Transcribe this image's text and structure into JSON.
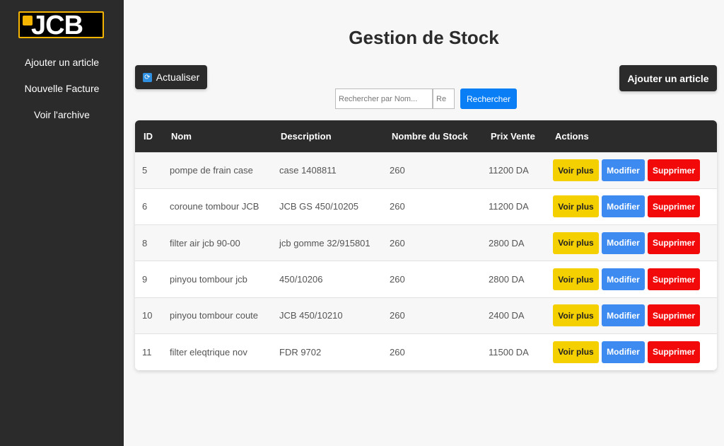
{
  "brand": {
    "logo_text": "JCB",
    "logo_mark": "JCB"
  },
  "sidebar": {
    "items": [
      {
        "label": "Ajouter un article"
      },
      {
        "label": "Nouvelle Facture"
      },
      {
        "label": "Voir l'archive"
      }
    ]
  },
  "page": {
    "title": "Gestion de Stock"
  },
  "toolbar": {
    "refresh_label": "Actualiser",
    "add_label": "Ajouter un article"
  },
  "search": {
    "name_placeholder": "Rechercher par Nom...",
    "ref_placeholder": "Re",
    "button_label": "Rechercher"
  },
  "table": {
    "headers": [
      "ID",
      "Nom",
      "Description",
      "Nombre du Stock",
      "Prix Vente",
      "Actions"
    ],
    "action_labels": {
      "view": "Voir plus",
      "edit": "Modifier",
      "delete": "Supprimer"
    },
    "rows": [
      {
        "id": "5",
        "nom": "pompe de frain case",
        "description": "case 1408811",
        "stock": "260",
        "prix": "11200 DA"
      },
      {
        "id": "6",
        "nom": "coroune tombour JCB",
        "description": "JCB GS 450/10205",
        "stock": "260",
        "prix": "11200 DA"
      },
      {
        "id": "8",
        "nom": "filter air jcb 90-00",
        "description": "jcb gomme 32/915801",
        "stock": "260",
        "prix": "2800 DA"
      },
      {
        "id": "9",
        "nom": "pinyou tombour jcb",
        "description": "450/10206",
        "stock": "260",
        "prix": "2800 DA"
      },
      {
        "id": "10",
        "nom": "pinyou tombour coute",
        "description": "JCB 450/10210",
        "stock": "260",
        "prix": "2400 DA"
      },
      {
        "id": "11",
        "nom": "filter eleqtrique nov",
        "description": "FDR 9702",
        "stock": "260",
        "prix": "11500 DA"
      }
    ]
  },
  "colors": {
    "sidebar": "#2b2b2b",
    "brand_yellow": "#f5b400",
    "view_button": "#f5d000",
    "edit_button": "#3d8bf0",
    "delete_button": "#f20a0a",
    "search_button": "#0a7ef5"
  }
}
